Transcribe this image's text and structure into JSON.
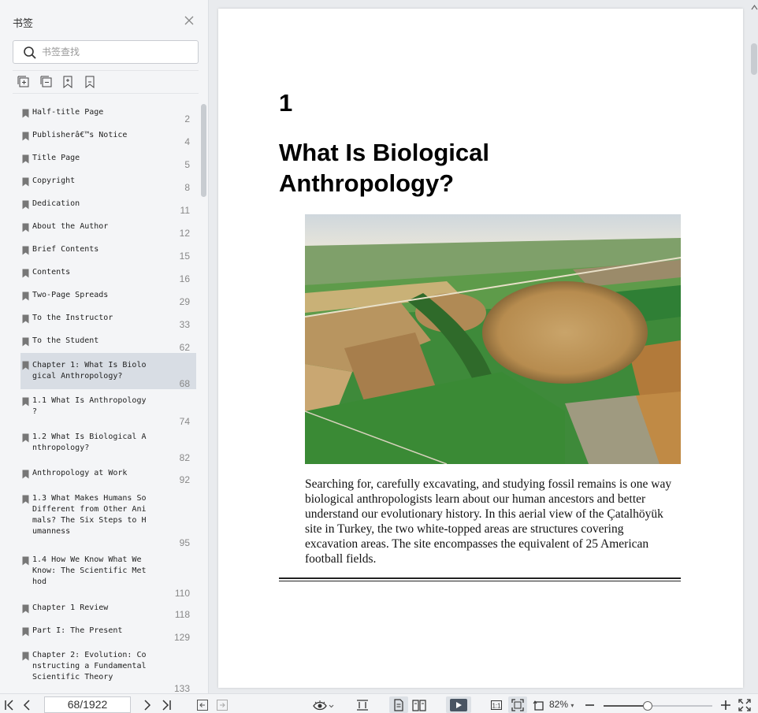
{
  "sidebar": {
    "title": "书签",
    "search_placeholder": "书签查找",
    "bookmarks": [
      {
        "label": "Half-title Page",
        "page": "2"
      },
      {
        "label": "Publisherâ€™s Notice",
        "page": "4"
      },
      {
        "label": "Title Page",
        "page": "5"
      },
      {
        "label": "Copyright",
        "page": "8"
      },
      {
        "label": "Dedication",
        "page": "11"
      },
      {
        "label": "About the Author",
        "page": "12"
      },
      {
        "label": "Brief Contents",
        "page": "15"
      },
      {
        "label": "Contents",
        "page": "16"
      },
      {
        "label": "Two-Page Spreads",
        "page": "29"
      },
      {
        "label": "To the Instructor",
        "page": "33"
      },
      {
        "label": "To the Student",
        "page": "62"
      },
      {
        "label": "Chapter 1: What Is Biolo\ngical Anthropology?",
        "page": "68"
      },
      {
        "label": "1.1 What Is Anthropology\n?",
        "page": "74"
      },
      {
        "label": "1.2 What Is Biological A\nnthropology?",
        "page": "82"
      },
      {
        "label": "Anthropology at Work",
        "page": "92"
      },
      {
        "label": "1.3 What Makes Humans So\nDifferent from Other Ani\nmals? The Six Steps to H\numanness",
        "page": "95"
      },
      {
        "label": "1.4 How We Know What We\nKnow: The Scientific Met\nhod",
        "page": "110"
      },
      {
        "label": "Chapter 1 Review",
        "page": "118"
      },
      {
        "label": "Part I: The Present",
        "page": "129"
      },
      {
        "label": "Chapter 2: Evolution: Co\nnstructing a Fundamental\nScientific Theory",
        "page": "133"
      }
    ]
  },
  "document": {
    "chapter_number": "1",
    "chapter_title": "What Is Biological Anthropology?",
    "caption": "Searching for, carefully excavating, and studying fossil remains is one way biological anthropologists learn about our human ancestors and better understand our evolutionary history. In this aerial view of the Çatalhöyük site in Turkey, the two white-topped areas are structures covering excavation areas. The site encompasses the equivalent of 25 American football fields."
  },
  "toolbar": {
    "page_indicator": "68/1922",
    "zoom": "82%"
  },
  "icons": [
    "close-icon",
    "search-icon",
    "expand-all-icon",
    "collapse-all-icon",
    "add-bookmark-icon",
    "bookmark-outline-icon",
    "bookmark-icon",
    "first-page-icon",
    "prev-page-icon",
    "next-page-icon",
    "last-page-icon",
    "back-icon",
    "forward-icon",
    "eye-icon",
    "fit-height-icon",
    "single-page-icon",
    "two-page-icon",
    "play-icon",
    "actual-size-icon",
    "fit-page-icon",
    "rotate-icon",
    "zoom-out-icon",
    "zoom-in-icon",
    "fullscreen-icon"
  ],
  "colors": {
    "active_bookmark": "#d8dde4",
    "sidebar_bg": "#f4f5f7"
  }
}
